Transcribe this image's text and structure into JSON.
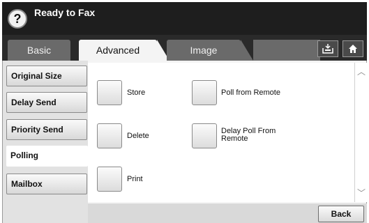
{
  "header": {
    "help_label": "?",
    "title": "Ready to Fax"
  },
  "tabs": [
    {
      "label": "Basic"
    },
    {
      "label": "Advanced"
    },
    {
      "label": "Image"
    }
  ],
  "toolbar_icons": {
    "tray": "inbox-tray-icon",
    "home": "home-icon"
  },
  "sidebar": {
    "items": [
      {
        "label": "Original Size"
      },
      {
        "label": "Delay Send"
      },
      {
        "label": "Priority Send"
      },
      {
        "label": "Polling"
      },
      {
        "label": "Mailbox"
      }
    ],
    "selected": "Polling"
  },
  "polling_options": {
    "store": "Store",
    "delete": "Delete",
    "print": "Print",
    "poll_from_remote": "Poll from Remote",
    "delay_poll_line1": "Delay Poll From",
    "delay_poll_line2": "Remote"
  },
  "footer": {
    "back_label": "Back"
  }
}
